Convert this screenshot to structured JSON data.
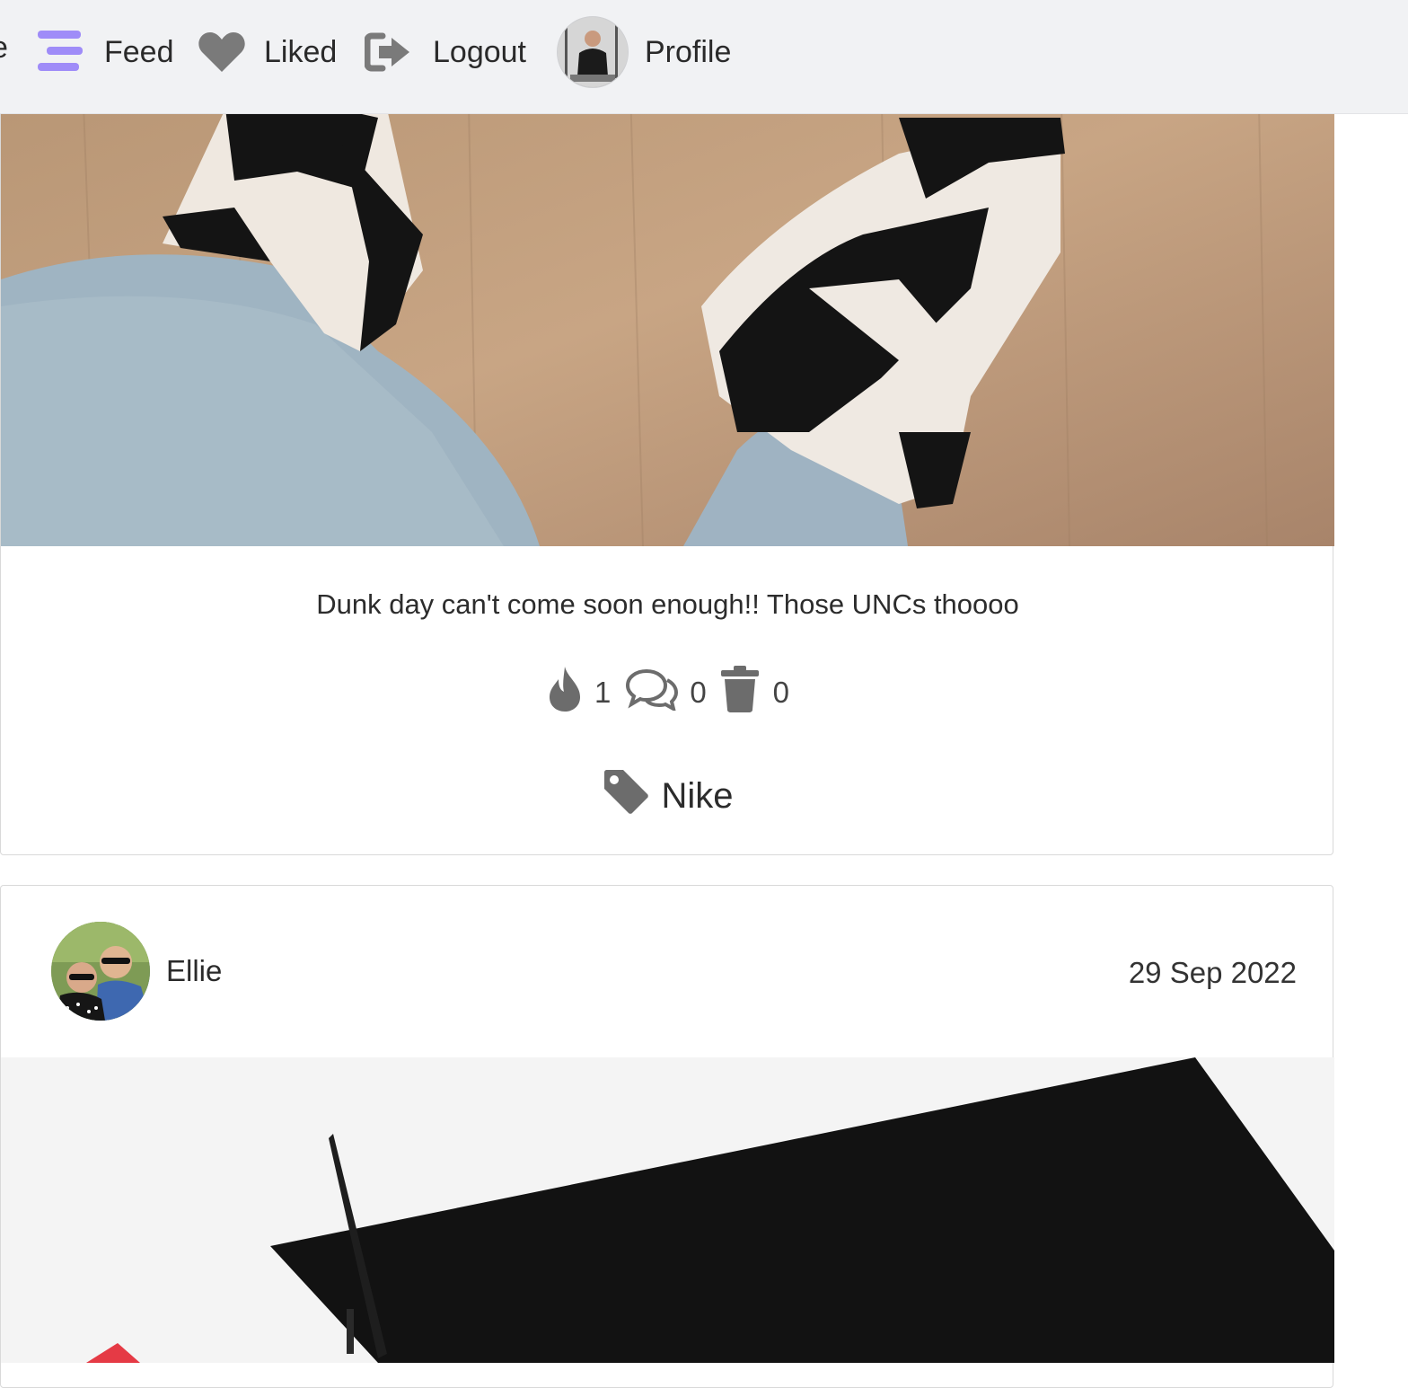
{
  "nav": {
    "partial_label": "e",
    "feed_label": "Feed",
    "liked_label": "Liked",
    "logout_label": "Logout",
    "profile_label": "Profile",
    "accent_color": "#9f8cf8",
    "icon_color": "#7a7a7a"
  },
  "post1": {
    "caption": "Dunk day can't come soon enough!! Those UNCs thoooo",
    "fire_count": "1",
    "comment_count": "0",
    "delete_count": "0",
    "tag": "Nike",
    "icons": [
      "fire-icon",
      "comments-icon",
      "trash-icon",
      "tag-icon"
    ]
  },
  "post2": {
    "author": "Ellie",
    "date": "29 Sep 2022"
  }
}
